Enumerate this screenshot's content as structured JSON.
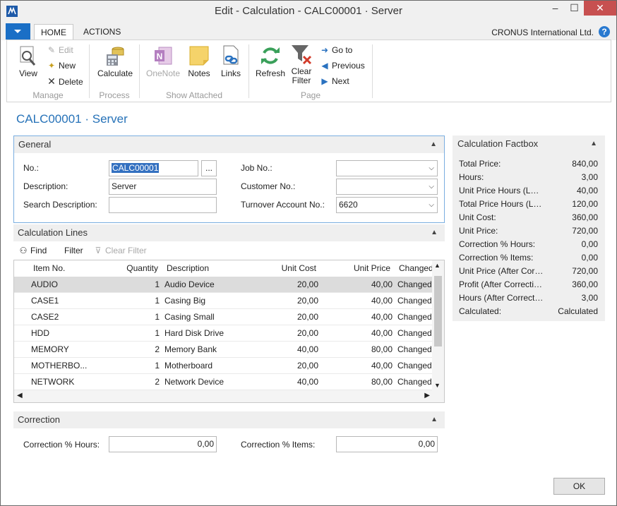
{
  "window": {
    "title": "Edit - Calculation - CALC00001 · Server",
    "min": "–",
    "max": "☐",
    "close": "✕"
  },
  "ribbon": {
    "tabs": [
      {
        "label": "HOME"
      },
      {
        "label": "ACTIONS"
      }
    ],
    "company": "CRONUS International Ltd.",
    "help": "?",
    "groups": {
      "manage": "Manage",
      "process": "Process",
      "show_attached": "Show Attached",
      "page": "Page"
    },
    "buttons": {
      "view": "View",
      "edit": "Edit",
      "new": "New",
      "delete": "Delete",
      "calculate": "Calculate",
      "onenote": "OneNote",
      "notes": "Notes",
      "links": "Links",
      "refresh": "Refresh",
      "clear_filter": "Clear\nFilter",
      "goto": "Go to",
      "previous": "Previous",
      "next": "Next"
    }
  },
  "page_title": "CALC00001 · Server",
  "general": {
    "header": "General",
    "no_label": "No.:",
    "no_value": "CALC00001",
    "assist": "...",
    "description_label": "Description:",
    "description_value": "Server",
    "search_description_label": "Search Description:",
    "search_description_value": "",
    "job_no_label": "Job No.:",
    "job_no_value": "",
    "customer_no_label": "Customer No.:",
    "customer_no_value": "",
    "turnover_label": "Turnover Account No.:",
    "turnover_value": "6620"
  },
  "lines": {
    "header": "Calculation Lines",
    "find": "Find",
    "filter": "Filter",
    "clear_filter": "Clear Filter",
    "columns": {
      "item_no": "Item No.",
      "quantity": "Quantity",
      "description": "Description",
      "unit_cost": "Unit Cost",
      "unit_price": "Unit Price",
      "changed": "Changed"
    },
    "rows": [
      {
        "item_no": "AUDIO",
        "quantity": "1",
        "description": "Audio Device",
        "unit_cost": "20,00",
        "unit_price": "40,00",
        "changed": "Changed"
      },
      {
        "item_no": "CASE1",
        "quantity": "1",
        "description": "Casing Big",
        "unit_cost": "20,00",
        "unit_price": "40,00",
        "changed": "Changed"
      },
      {
        "item_no": "CASE2",
        "quantity": "1",
        "description": "Casing Small",
        "unit_cost": "20,00",
        "unit_price": "40,00",
        "changed": "Changed"
      },
      {
        "item_no": "HDD",
        "quantity": "1",
        "description": "Hard Disk Drive",
        "unit_cost": "20,00",
        "unit_price": "40,00",
        "changed": "Changed"
      },
      {
        "item_no": "MEMORY",
        "quantity": "2",
        "description": "Memory Bank",
        "unit_cost": "40,00",
        "unit_price": "80,00",
        "changed": "Changed"
      },
      {
        "item_no": "MOTHERBO...",
        "quantity": "1",
        "description": "Motherboard",
        "unit_cost": "20,00",
        "unit_price": "40,00",
        "changed": "Changed"
      },
      {
        "item_no": "NETWORK",
        "quantity": "2",
        "description": "Network Device",
        "unit_cost": "40,00",
        "unit_price": "80,00",
        "changed": "Changed"
      }
    ]
  },
  "correction": {
    "header": "Correction",
    "hours_label": "Correction % Hours:",
    "hours_value": "0,00",
    "items_label": "Correction % Items:",
    "items_value": "0,00"
  },
  "factbox": {
    "header": "Calculation Factbox",
    "rows": [
      {
        "label": "Total Price:",
        "value": "840,00"
      },
      {
        "label": "Hours:",
        "value": "3,00"
      },
      {
        "label": "Unit Price Hours (LCY):",
        "value": "40,00"
      },
      {
        "label": "Total Price Hours (LCY):",
        "value": "120,00"
      },
      {
        "label": "Unit Cost:",
        "value": "360,00"
      },
      {
        "label": "Unit Price:",
        "value": "720,00"
      },
      {
        "label": "Correction % Hours:",
        "value": "0,00"
      },
      {
        "label": "Correction % Items:",
        "value": "0,00"
      },
      {
        "label": "Unit Price (After Correction):",
        "value": "720,00"
      },
      {
        "label": "Profit (After Correction):",
        "value": "360,00"
      },
      {
        "label": "Hours (After Correction):",
        "value": "3,00"
      },
      {
        "label": "Calculated:",
        "value": "Calculated"
      }
    ]
  },
  "ok": "OK"
}
